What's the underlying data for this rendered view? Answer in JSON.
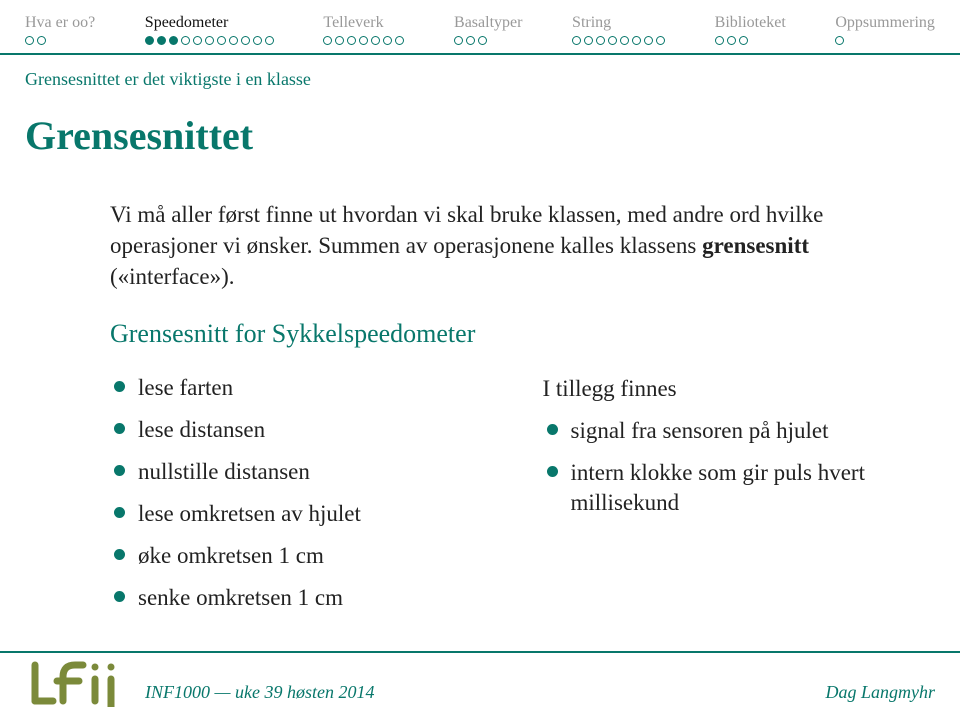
{
  "nav": [
    {
      "label": "Hva er oo?",
      "dots": 2,
      "filled": 0,
      "current": false
    },
    {
      "label": "Speedometer",
      "dots": 11,
      "filled": 3,
      "current": true
    },
    {
      "label": "Telleverk",
      "dots": 7,
      "filled": 0,
      "current": false
    },
    {
      "label": "Basaltyper",
      "dots": 3,
      "filled": 0,
      "current": false
    },
    {
      "label": "String",
      "dots": 8,
      "filled": 0,
      "current": false
    },
    {
      "label": "Biblioteket",
      "dots": 3,
      "filled": 0,
      "current": false
    },
    {
      "label": "Oppsummering",
      "dots": 1,
      "filled": 0,
      "current": false
    }
  ],
  "subtitle": "Grensesnittet er det viktigste i en klasse",
  "title": "Grensesnittet",
  "para_plain_1": "Vi må aller først finne ut hvordan vi skal bruke klassen, med andre ord hvilke operasjoner vi ønsker. Summen av operasjonene kalles klassens ",
  "para_bold": "grensesnitt",
  "para_plain_2": " («interface»).",
  "section_heading": "Grensesnitt for Sykkelspeedometer",
  "left_bullets": [
    "lese farten",
    "lese distansen",
    "nullstille distansen",
    "lese omkretsen av hjulet",
    "øke omkretsen 1 cm",
    "senke omkretsen 1 cm"
  ],
  "right_lead": "I tillegg finnes",
  "right_bullets": [
    "signal fra sensoren på hjulet",
    "intern klokke som gir puls hvert millisekund"
  ],
  "footer": {
    "course": "INF1000 — uke 39 høsten 2014",
    "author": "Dag Langmyhr"
  }
}
